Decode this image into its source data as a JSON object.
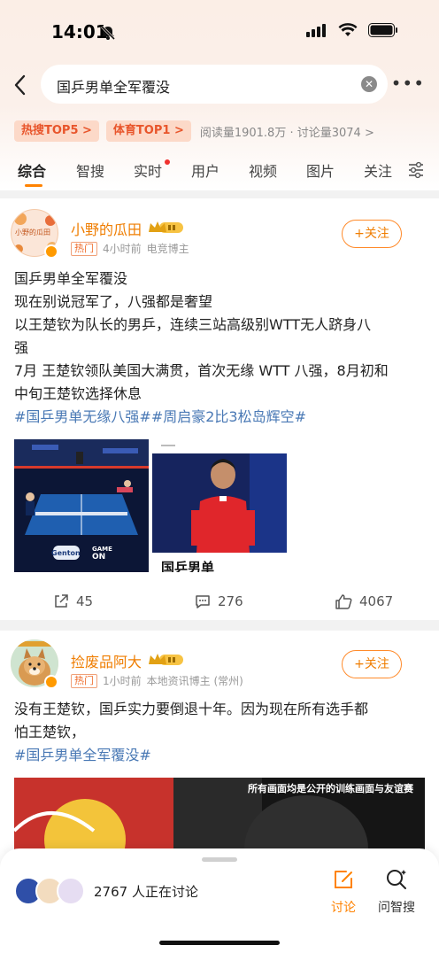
{
  "status_bar": {
    "time": "14:01"
  },
  "search": {
    "query": "国乒男单全军覆没"
  },
  "topic_stats": {
    "hot_tag": "热搜TOP5 >",
    "sports_tag": "体育TOP1 >",
    "reads_discussions": "阅读量1901.8万 · 讨论量3074 >"
  },
  "tabs": [
    {
      "label": "综合"
    },
    {
      "label": "智搜"
    },
    {
      "label": "实时"
    },
    {
      "label": "用户"
    },
    {
      "label": "视频"
    },
    {
      "label": "图片"
    },
    {
      "label": "关注"
    }
  ],
  "posts": [
    {
      "avatar_text": "小野的瓜田",
      "author": "小野的瓜田",
      "hot_label": "热门",
      "time": "4小时前",
      "role": "电竞博主",
      "follow_label": "+关注",
      "lines": [
        "国乒男单全军覆没",
        "现在别说冠军了，八强都是奢望",
        "以王楚钦为队长的男乒，连续三站高级别WTT无人跻身八",
        "强",
        "7月 王楚钦领队美国大满贯，首次无缘 WTT 八强，8月初和",
        "中旬王楚钦选择休息"
      ],
      "hashtags": "#国乒男单无缘八强##周启豪2比3松岛辉空#",
      "image_caption": "国乒男单",
      "image_logo_1": "GAME",
      "image_logo_2": "ON",
      "image_logo_3": "Genton",
      "shares": "45",
      "comments": "276",
      "likes": "4067"
    },
    {
      "author": "捡废品阿大",
      "hot_label": "热门",
      "time": "1小时前",
      "role": "本地资讯博主 (常州)",
      "follow_label": "+关注",
      "lines": [
        "没有王楚钦，国乒实力要倒退十年。因为现在所有选手都",
        "怕王楚钦，"
      ],
      "hashtags": "#国乒男单全军覆没#",
      "banner_text": "所有画面均是公开的训练画面与友谊赛"
    }
  ],
  "bottom_bar": {
    "discussing": "2767 人正在讨论",
    "discuss_label": "讨论",
    "ask_label": "问智搜"
  },
  "colors": {
    "accent": "#ff8200",
    "username": "#ef7d00",
    "hashtag": "#4a79b5",
    "tag_bg": "#fcd9c8"
  }
}
